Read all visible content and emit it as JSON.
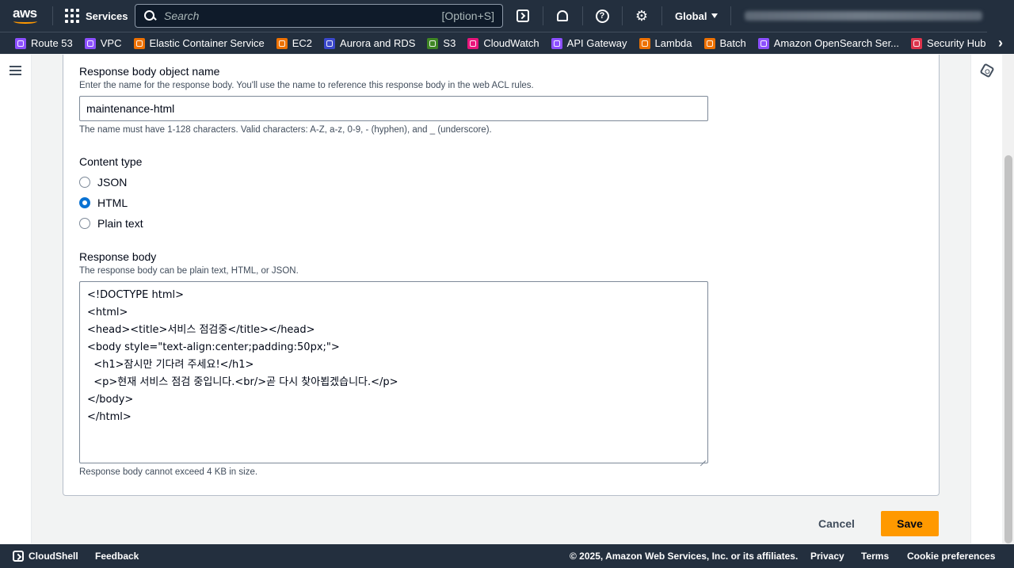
{
  "topnav": {
    "logo_text": "aws",
    "services_label": "Services",
    "search_placeholder": "Search",
    "search_shortcut": "[Option+S]",
    "region": "Global",
    "icons": [
      "cloudshell-icon",
      "notifications-icon",
      "help-icon",
      "settings-icon"
    ]
  },
  "favorites": [
    {
      "label": "Route 53",
      "color": "#8c4fff"
    },
    {
      "label": "VPC",
      "color": "#8c4fff"
    },
    {
      "label": "Elastic Container Service",
      "color": "#ed7100"
    },
    {
      "label": "EC2",
      "color": "#ed7100"
    },
    {
      "label": "Aurora and RDS",
      "color": "#3b48cc"
    },
    {
      "label": "S3",
      "color": "#3f8624"
    },
    {
      "label": "CloudWatch",
      "color": "#e7157b"
    },
    {
      "label": "API Gateway",
      "color": "#8c4fff"
    },
    {
      "label": "Lambda",
      "color": "#ed7100"
    },
    {
      "label": "Batch",
      "color": "#ed7100"
    },
    {
      "label": "Amazon OpenSearch Ser...",
      "color": "#8c4fff"
    },
    {
      "label": "Security Hub",
      "color": "#dd344c"
    },
    {
      "label": "",
      "color": "#dd344c"
    }
  ],
  "form": {
    "name_label": "Response body object name",
    "name_desc": "Enter the name for the response body. You'll use the name to reference this response body in the web ACL rules.",
    "name_value": "maintenance-html",
    "name_constraint": "The name must have 1-128 characters. Valid characters: A-Z, a-z, 0-9, - (hyphen), and _ (underscore).",
    "content_type_label": "Content type",
    "content_types": [
      {
        "label": "JSON",
        "selected": false
      },
      {
        "label": "HTML",
        "selected": true
      },
      {
        "label": "Plain text",
        "selected": false
      }
    ],
    "body_label": "Response body",
    "body_desc": "The response body can be plain text, HTML, or JSON.",
    "body_value": "<!DOCTYPE html>\n<html>\n<head><title>서비스 점검중</title></head>\n<body style=\"text-align:center;padding:50px;\">\n  <h1>잠시만 기다려 주세요!</h1>\n  <p>현재 서비스 점검 중입니다.<br/>곧 다시 찾아뵙겠습니다.</p>\n</body>\n</html>",
    "body_constraint": "Response body cannot exceed 4 KB in size."
  },
  "actions": {
    "cancel": "Cancel",
    "save": "Save",
    "save_color": "#ff9900"
  },
  "footer": {
    "cloudshell": "CloudShell",
    "feedback": "Feedback",
    "copyright": "© 2025, Amazon Web Services, Inc. or its affiliates.",
    "privacy": "Privacy",
    "terms": "Terms",
    "cookies": "Cookie preferences"
  }
}
